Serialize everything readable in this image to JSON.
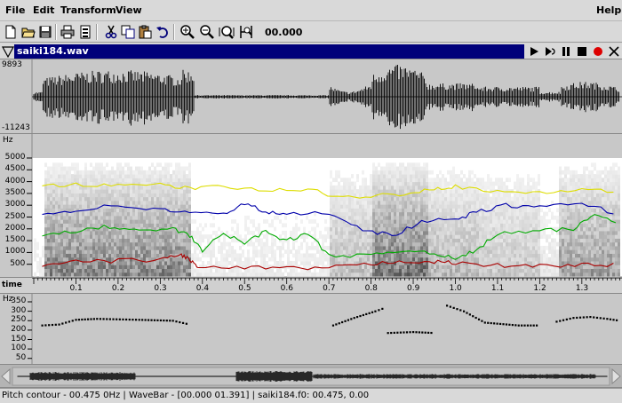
{
  "menus": {
    "file": "File",
    "edit": "Edit",
    "transform": "Transform",
    "view": "View",
    "help": "Help"
  },
  "toolbar": {
    "icons": [
      "new-file-icon",
      "open-folder-icon",
      "save-icon",
      "print-icon",
      "print-setup-icon",
      "cut-icon",
      "copy-icon",
      "paste-icon",
      "undo-icon",
      "zoom-in-icon",
      "zoom-out-icon",
      "zoom-fit-icon",
      "zoom-selection-icon"
    ],
    "time_display": "00.000"
  },
  "file_window": {
    "filename": "saiki184.wav"
  },
  "waveform": {
    "max_label": "9893",
    "min_label": "-11243"
  },
  "spectrogram": {
    "unit": "Hz",
    "y_ticks": [
      "5000",
      "4500",
      "4000",
      "3500",
      "3000",
      "2500",
      "2000",
      "1500",
      "1000",
      "500"
    ]
  },
  "time_axis": {
    "label": "time",
    "ticks": [
      "0.1",
      "0.2",
      "0.3",
      "0.4",
      "0.5",
      "0.6",
      "0.7",
      "0.8",
      "0.9",
      "1.0",
      "1.1",
      "1.2",
      "1.3"
    ]
  },
  "pitch": {
    "unit": "Hz",
    "y_ticks": [
      "350",
      "300",
      "250",
      "200",
      "150",
      "100",
      "50"
    ]
  },
  "status": "Pitch contour - 00.475 0Hz  | WaveBar - [00.000 01.391] | saiki184.f0: 00.475, 0.00",
  "colors": {
    "title_bar": "#00007a",
    "formant1": "#aa0000",
    "formant2": "#00aa00",
    "formant3": "#0000aa",
    "formant4": "#dddd00",
    "record": "#dd0000"
  }
}
